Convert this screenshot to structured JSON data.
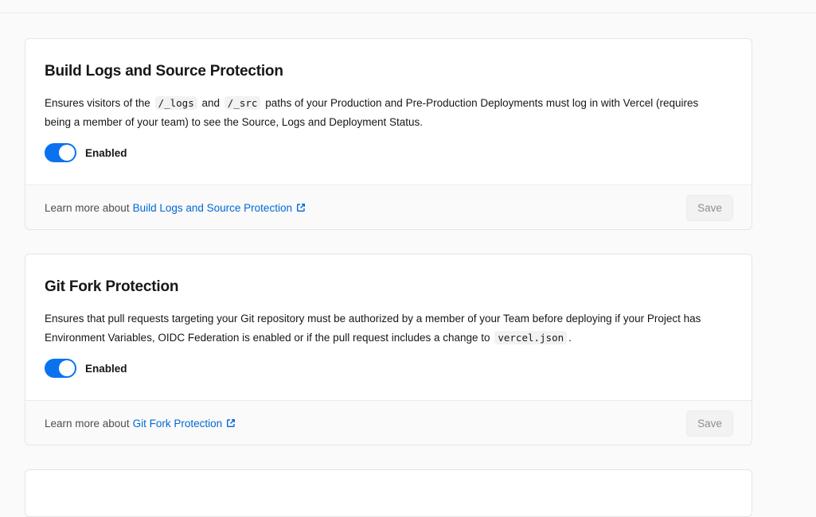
{
  "cards": [
    {
      "title": "Build Logs and Source Protection",
      "desc_parts": [
        "Ensures visitors of the",
        "/_logs",
        "and",
        "/_src",
        "paths of your Production and Pre-Production Deployments must log in with Vercel (requires being a member of your team) to see the Source, Logs and Deployment Status."
      ],
      "toggle_label": "Enabled",
      "toggle_on": true,
      "learn_prefix": "Learn more about",
      "learn_link": "Build Logs and Source Protection",
      "save_label": "Save"
    },
    {
      "title": "Git Fork Protection",
      "desc_parts": [
        "Ensures that pull requests targeting your Git repository must be authorized by a member of your Team before deploying if your Project has Environment Variables, OIDC Federation is enabled or if the pull request includes a change to",
        "vercel.json",
        "."
      ],
      "toggle_label": "Enabled",
      "toggle_on": true,
      "learn_prefix": "Learn more about",
      "learn_link": "Git Fork Protection",
      "save_label": "Save"
    }
  ],
  "colors": {
    "accent": "#0a72ef",
    "link": "#0068d6"
  },
  "icons": {
    "external_link": "external-link-icon"
  }
}
